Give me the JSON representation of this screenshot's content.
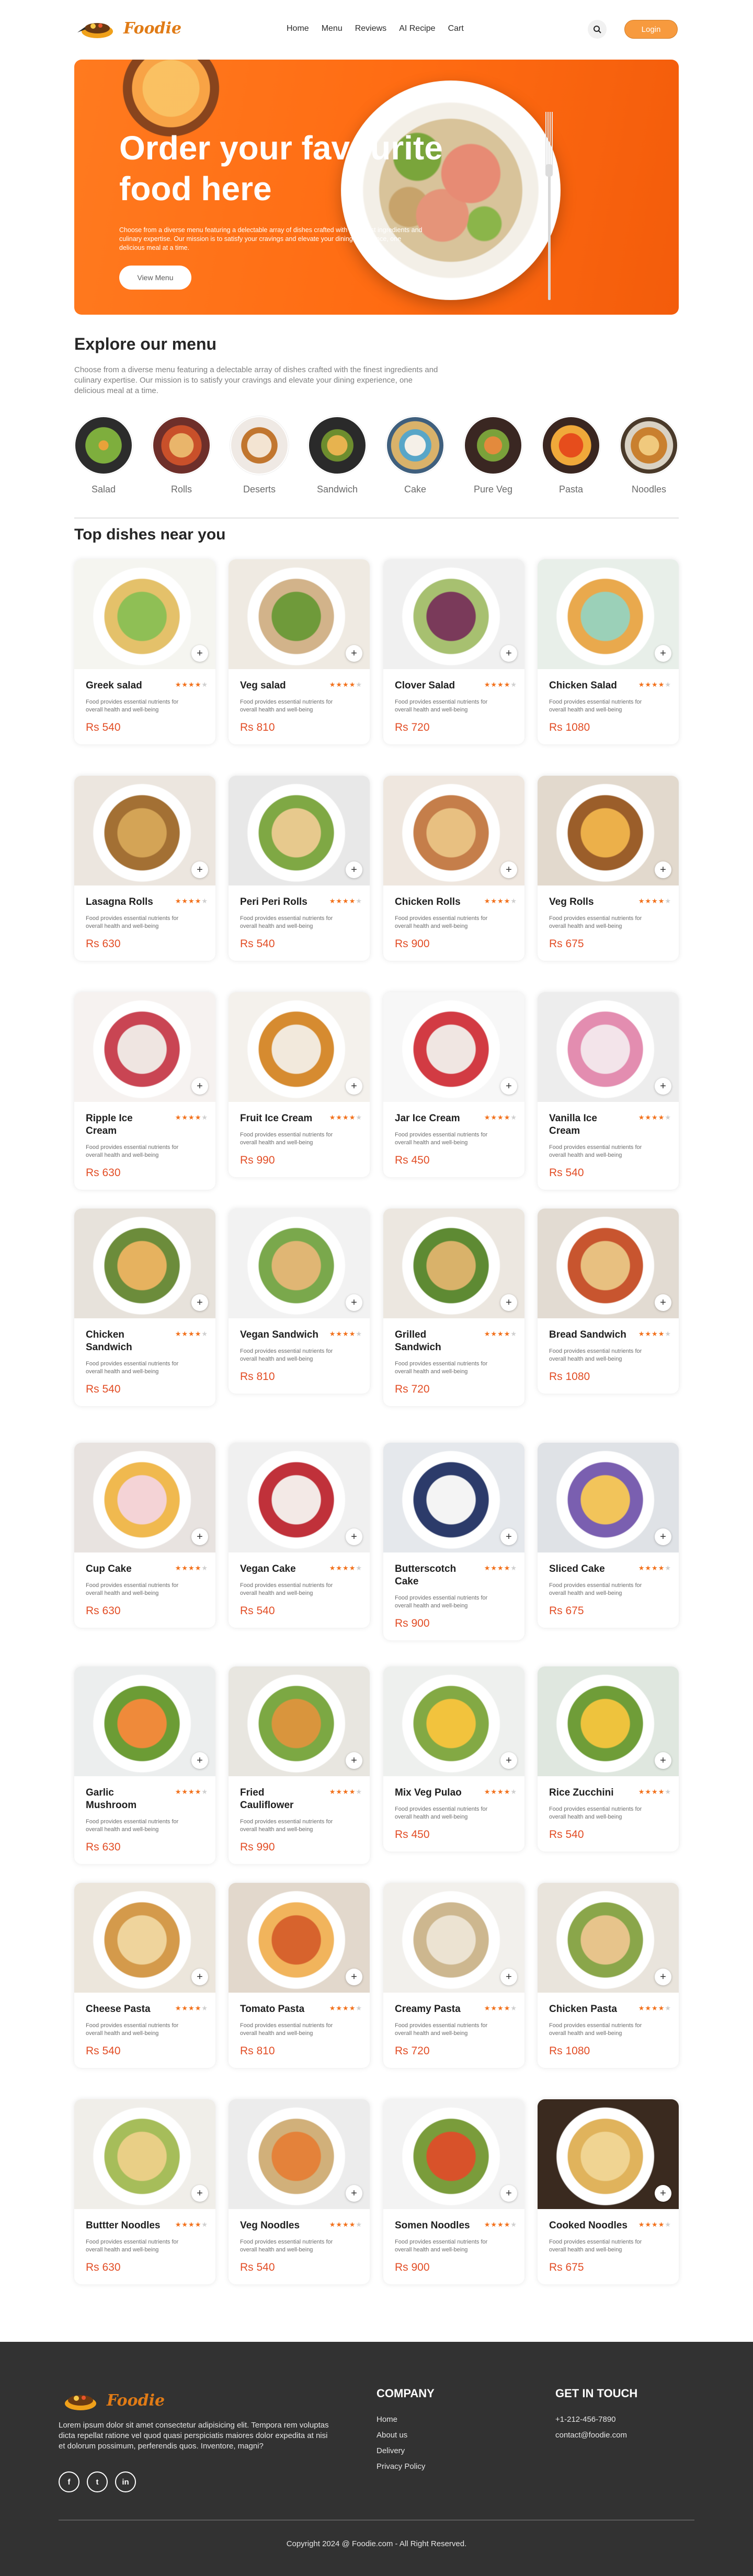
{
  "brand": {
    "name": "Foodie",
    "accent": "#f79a3e",
    "price_color": "#e24d25",
    "star_color": "#f2711c"
  },
  "nav": {
    "items": [
      "Home",
      "Menu",
      "Reviews",
      "AI Recipe",
      "Cart"
    ],
    "search_icon": "search-icon",
    "login_label": "Login"
  },
  "hero": {
    "title": "Order your favourite food here",
    "description": "Choose from a diverse menu featuring a delectable array of dishes crafted with the finest ingredients and culinary expertise. Our mission is to satisfy your cravings and elevate your dining experience, one delicious meal at a time.",
    "button_label": "View Menu"
  },
  "explore": {
    "title": "Explore our menu",
    "description": "Choose from a diverse menu featuring a delectable array of dishes crafted with the finest ingredients and culinary expertise. Our mission is to satisfy your cravings and elevate your dining experience, one delicious meal at a time.",
    "categories": [
      "Salad",
      "Rolls",
      "Deserts",
      "Sandwich",
      "Cake",
      "Pure Veg",
      "Pasta",
      "Noodles"
    ]
  },
  "dishes": {
    "title": "Top dishes near you",
    "common_description": "Food provides essential nutrients for overall health and well-being",
    "items": [
      {
        "name": "Greek salad",
        "price": "Rs 540",
        "rating": 4
      },
      {
        "name": "Veg salad",
        "price": "Rs 810",
        "rating": 4
      },
      {
        "name": "Clover Salad",
        "price": "Rs 720",
        "rating": 4
      },
      {
        "name": "Chicken Salad",
        "price": "Rs 1080",
        "rating": 4
      },
      {
        "name": "Lasagna Rolls",
        "price": "Rs 630",
        "rating": 4
      },
      {
        "name": "Peri Peri Rolls",
        "price": "Rs 540",
        "rating": 4
      },
      {
        "name": "Chicken Rolls",
        "price": "Rs 900",
        "rating": 4
      },
      {
        "name": "Veg Rolls",
        "price": "Rs 675",
        "rating": 4
      },
      {
        "name": "Ripple Ice Cream",
        "price": "Rs 630",
        "rating": 4
      },
      {
        "name": "Fruit Ice Cream",
        "price": "Rs 990",
        "rating": 4
      },
      {
        "name": "Jar Ice Cream",
        "price": "Rs 450",
        "rating": 4
      },
      {
        "name": "Vanilla Ice Cream",
        "price": "Rs 540",
        "rating": 4
      },
      {
        "name": "Chicken Sandwich",
        "price": "Rs 540",
        "rating": 4
      },
      {
        "name": "Vegan Sandwich",
        "price": "Rs 810",
        "rating": 4
      },
      {
        "name": "Grilled Sandwich",
        "price": "Rs 720",
        "rating": 4
      },
      {
        "name": "Bread Sandwich",
        "price": "Rs 1080",
        "rating": 4
      },
      {
        "name": "Cup Cake",
        "price": "Rs 630",
        "rating": 4
      },
      {
        "name": "Vegan Cake",
        "price": "Rs 540",
        "rating": 4
      },
      {
        "name": "Butterscotch Cake",
        "price": "Rs 900",
        "rating": 4
      },
      {
        "name": "Sliced Cake",
        "price": "Rs 675",
        "rating": 4
      },
      {
        "name": "Garlic Mushroom",
        "price": "Rs 630",
        "rating": 4
      },
      {
        "name": "Fried Cauliflower",
        "price": "Rs 990",
        "rating": 4
      },
      {
        "name": "Mix Veg Pulao",
        "price": "Rs 450",
        "rating": 4
      },
      {
        "name": "Rice Zucchini",
        "price": "Rs 540",
        "rating": 4
      },
      {
        "name": "Cheese Pasta",
        "price": "Rs 540",
        "rating": 4
      },
      {
        "name": "Tomato Pasta",
        "price": "Rs 810",
        "rating": 4
      },
      {
        "name": "Creamy Pasta",
        "price": "Rs 720",
        "rating": 4
      },
      {
        "name": "Chicken Pasta",
        "price": "Rs 1080",
        "rating": 4
      },
      {
        "name": "Buttter Noodles",
        "price": "Rs 630",
        "rating": 4
      },
      {
        "name": "Veg Noodles",
        "price": "Rs 540",
        "rating": 4
      },
      {
        "name": "Somen Noodles",
        "price": "Rs 900",
        "rating": 4
      },
      {
        "name": "Cooked Noodles",
        "price": "Rs 675",
        "rating": 4
      }
    ]
  },
  "footer": {
    "about": "Lorem ipsum dolor sit amet consectetur adipisicing elit. Tempora rem voluptas dicta repellat ratione vel quod quasi perspiciatis maiores dolor expedita at nisi et dolorum possimum, perferendis quos. Inventore, magni?",
    "social": [
      "f",
      "t",
      "in"
    ],
    "company_title": "COMPANY",
    "company_links": [
      "Home",
      "About us",
      "Delivery",
      "Privacy Policy"
    ],
    "contact_title": "GET IN TOUCH",
    "contact": [
      "+1-212-456-7890",
      "contact@foodie.com"
    ],
    "copyright": "Copyright 2024 @ Foodie.com - All Right Reserved."
  }
}
